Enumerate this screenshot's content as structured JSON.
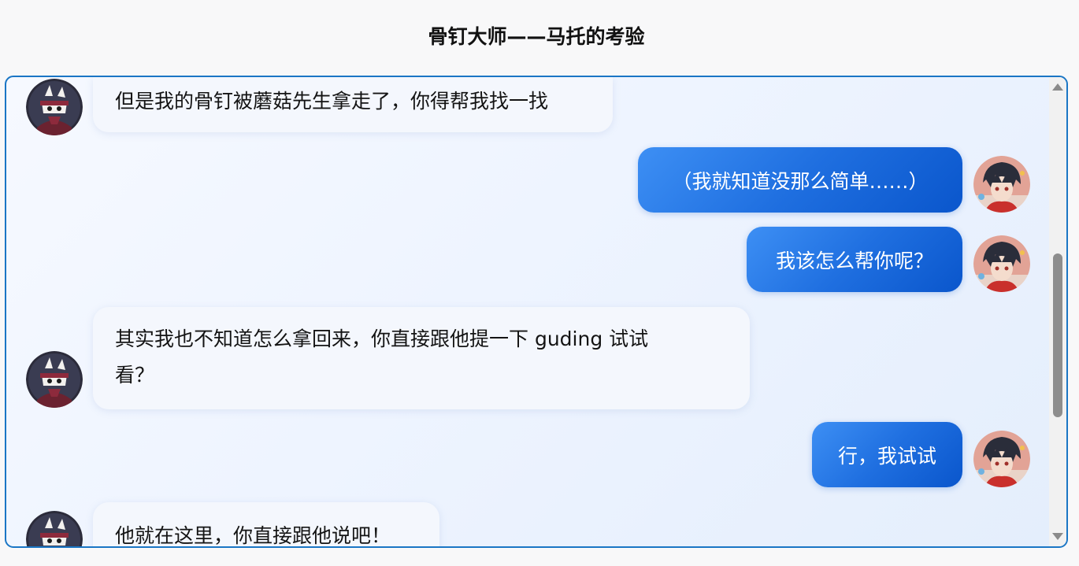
{
  "page": {
    "title": "骨钉大师——马托的考验"
  },
  "messages": [
    {
      "role": "npc",
      "avatar": "npc-avatar-icon",
      "text": "但是我的骨钉被蘑菇先生拿走了，你得帮我找一找"
    },
    {
      "role": "user",
      "avatar": "user-avatar-icon",
      "text": "（我就知道没那么简单……）"
    },
    {
      "role": "user",
      "avatar": "user-avatar-icon",
      "text": "我该怎么帮你呢？"
    },
    {
      "role": "npc",
      "avatar": "npc-avatar-icon",
      "line1": "其实我也不知道怎么拿回来，你直接跟他提一下 guding 试试",
      "line2": "看？"
    },
    {
      "role": "user",
      "avatar": "user-avatar-icon",
      "text": "行，我试试"
    },
    {
      "role": "npc",
      "avatar": "npc-avatar-icon",
      "text": "他就在这里，你直接跟他说吧！"
    }
  ],
  "colors": {
    "frame_border": "#1a76c5",
    "user_bubble": "#1f6fe0",
    "npc_bubble": "#f4f7fd"
  }
}
